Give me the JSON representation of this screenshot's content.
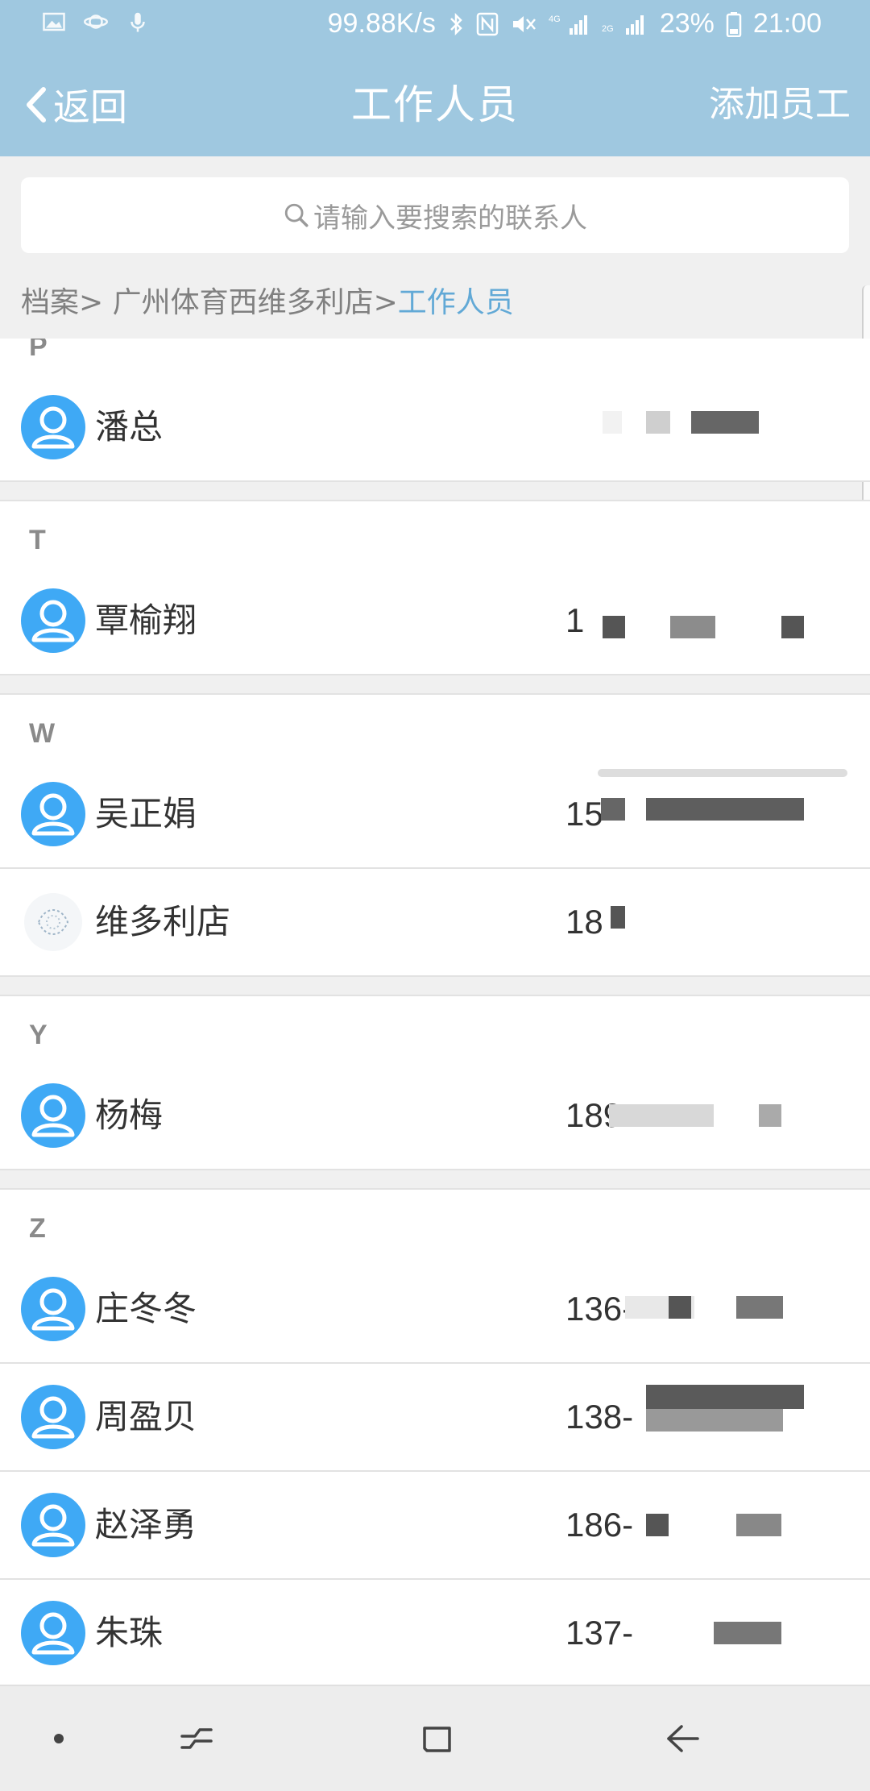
{
  "statusbar": {
    "speed": "99.88K/s",
    "battery": "23%",
    "time": "21:00"
  },
  "header": {
    "back_label": "返回",
    "title": "工作人员",
    "add_label": "添加员工"
  },
  "search": {
    "placeholder": "请输入要搜索的联系人"
  },
  "breadcrumb": {
    "path": "档案> 广州体育西维多利店>",
    "current": "工作人员"
  },
  "contacts": {
    "sections": [
      {
        "letter": "P",
        "items": [
          {
            "name": "潘总",
            "phone": ""
          }
        ]
      },
      {
        "letter": "T",
        "items": [
          {
            "name": "覃榆翔",
            "phone": "1"
          }
        ]
      },
      {
        "letter": "W",
        "items": [
          {
            "name": "吴正娟",
            "phone": "15"
          },
          {
            "name": "维多利店",
            "phone": "18"
          }
        ]
      },
      {
        "letter": "Y",
        "items": [
          {
            "name": "杨梅",
            "phone": "189"
          }
        ]
      },
      {
        "letter": "Z",
        "items": [
          {
            "name": "庄冬冬",
            "phone": "136-"
          },
          {
            "name": "周盈贝",
            "phone": "138-"
          },
          {
            "name": "赵泽勇",
            "phone": "186-"
          },
          {
            "name": "朱珠",
            "phone": "137-"
          }
        ]
      }
    ]
  },
  "colors": {
    "header_bg": "#9fc8e0",
    "accent": "#62a9d6",
    "avatar": "#3fa9f5"
  }
}
